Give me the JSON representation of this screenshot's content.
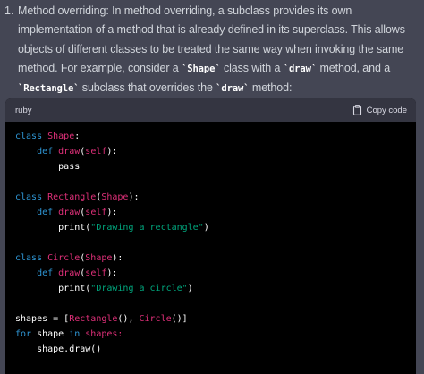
{
  "list": {
    "number": "1.",
    "paragraph": {
      "part1": "Method overriding: In method overriding, a subclass provides its own implementation of a method that is already defined in its superclass. This allows objects of different classes to be treated the same way when invoking the same method. For example, consider a ",
      "code1": "`Shape`",
      "part2": " class with a ",
      "code2": "`draw`",
      "part3": " method, and a ",
      "code3": "`Rectangle`",
      "part4": " subclass that overrides the ",
      "code4": "`draw`",
      "part5": " method:"
    }
  },
  "code_block": {
    "language": "ruby",
    "copy_label": "Copy code",
    "copy_icon": "clipboard-icon",
    "lines": [
      [
        {
          "t": "class ",
          "c": "kw"
        },
        {
          "t": "Shape",
          "c": "cls"
        },
        {
          "t": ":",
          "c": "plain"
        }
      ],
      [
        {
          "t": "    def ",
          "c": "kw"
        },
        {
          "t": "draw",
          "c": "cls"
        },
        {
          "t": "(",
          "c": "plain"
        },
        {
          "t": "self",
          "c": "cls"
        },
        {
          "t": "):",
          "c": "plain"
        }
      ],
      [
        {
          "t": "        pass",
          "c": "plain"
        }
      ],
      [],
      [
        {
          "t": "class ",
          "c": "kw"
        },
        {
          "t": "Rectangle",
          "c": "cls"
        },
        {
          "t": "(",
          "c": "plain"
        },
        {
          "t": "Shape",
          "c": "cls"
        },
        {
          "t": "):",
          "c": "plain"
        }
      ],
      [
        {
          "t": "    def ",
          "c": "kw"
        },
        {
          "t": "draw",
          "c": "cls"
        },
        {
          "t": "(",
          "c": "plain"
        },
        {
          "t": "self",
          "c": "cls"
        },
        {
          "t": "):",
          "c": "plain"
        }
      ],
      [
        {
          "t": "        print(",
          "c": "plain"
        },
        {
          "t": "\"Drawing a rectangle\"",
          "c": "str"
        },
        {
          "t": ")",
          "c": "plain"
        }
      ],
      [],
      [
        {
          "t": "class ",
          "c": "kw"
        },
        {
          "t": "Circle",
          "c": "cls"
        },
        {
          "t": "(",
          "c": "plain"
        },
        {
          "t": "Shape",
          "c": "cls"
        },
        {
          "t": "):",
          "c": "plain"
        }
      ],
      [
        {
          "t": "    def ",
          "c": "kw"
        },
        {
          "t": "draw",
          "c": "cls"
        },
        {
          "t": "(",
          "c": "plain"
        },
        {
          "t": "self",
          "c": "cls"
        },
        {
          "t": "):",
          "c": "plain"
        }
      ],
      [
        {
          "t": "        print(",
          "c": "plain"
        },
        {
          "t": "\"Drawing a circle\"",
          "c": "str"
        },
        {
          "t": ")",
          "c": "plain"
        }
      ],
      [],
      [
        {
          "t": "shapes = [",
          "c": "plain"
        },
        {
          "t": "Rectangle",
          "c": "cls"
        },
        {
          "t": "(), ",
          "c": "plain"
        },
        {
          "t": "Circle",
          "c": "cls"
        },
        {
          "t": "()]",
          "c": "plain"
        }
      ],
      [
        {
          "t": "for ",
          "c": "kw"
        },
        {
          "t": "shape ",
          "c": "plain"
        },
        {
          "t": "in ",
          "c": "kw"
        },
        {
          "t": "shapes:",
          "c": "cls"
        }
      ],
      [
        {
          "t": "    shape.draw()",
          "c": "plain"
        }
      ]
    ]
  },
  "colors": {
    "background": "#444654",
    "code_background": "#000000",
    "code_header": "#343541",
    "keyword": "#2e95d3",
    "class_name": "#df3079",
    "string": "#00a67d"
  }
}
